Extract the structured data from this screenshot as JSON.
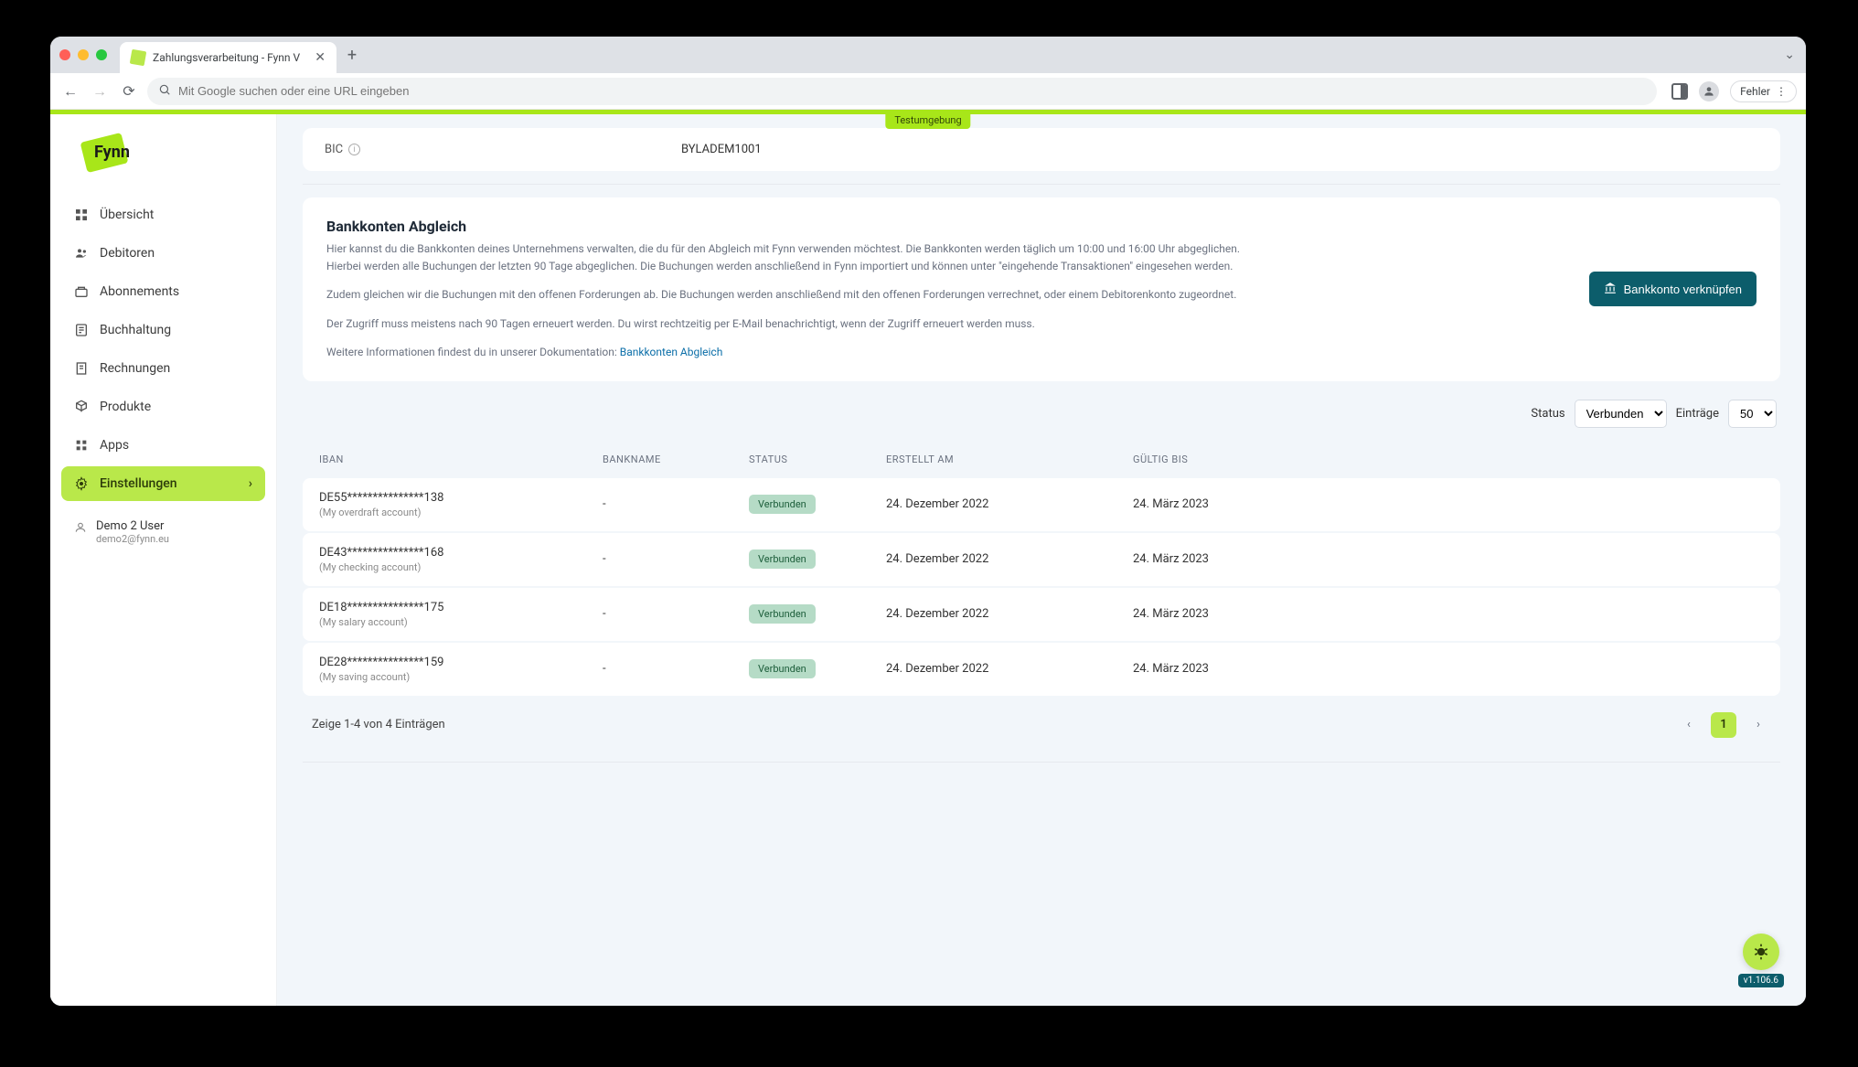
{
  "browser": {
    "tab_title": "Zahlungsverarbeitung - Fynn V",
    "address_placeholder": "Mit Google suchen oder eine URL eingeben",
    "error_label": "Fehler"
  },
  "env_badge": "Testumgebung",
  "logo_text": "Fynn",
  "sidebar": {
    "items": [
      {
        "label": "Übersicht",
        "icon": "dashboard-icon"
      },
      {
        "label": "Debitoren",
        "icon": "people-icon"
      },
      {
        "label": "Abonnements",
        "icon": "subscription-icon"
      },
      {
        "label": "Buchhaltung",
        "icon": "accounting-icon"
      },
      {
        "label": "Rechnungen",
        "icon": "invoice-icon"
      },
      {
        "label": "Produkte",
        "icon": "products-icon"
      },
      {
        "label": "Apps",
        "icon": "apps-icon"
      },
      {
        "label": "Einstellungen",
        "icon": "settings-icon"
      }
    ],
    "user": {
      "name": "Demo 2 User",
      "email": "demo2@fynn.eu"
    }
  },
  "bic": {
    "label": "BIC",
    "value": "BYLADEM1001"
  },
  "card": {
    "title": "Bankkonten Abgleich",
    "p1": "Hier kannst du die Bankkonten deines Unternehmens verwalten, die du für den Abgleich mit Fynn verwenden möchtest. Die Bankkonten werden täglich um 10:00 und 16:00 Uhr abgeglichen.",
    "p2": "Hierbei werden alle Buchungen der letzten 90 Tage abgeglichen. Die Buchungen werden anschließend in Fynn importiert und können unter \"eingehende Transaktionen\" eingesehen werden.",
    "p3": "Zudem gleichen wir die Buchungen mit den offenen Forderungen ab. Die Buchungen werden anschließend mit den offenen Forderungen verrechnet, oder einem Debitorenkonto zugeordnet.",
    "p4": "Der Zugriff muss meistens nach 90 Tagen erneuert werden. Du wirst rechtzeitig per E-Mail benachrichtigt, wenn der Zugriff erneuert werden muss.",
    "doc_prefix": "Weitere Informationen findest du in unserer Dokumentation: ",
    "doc_link": "Bankkonten Abgleich",
    "button": "Bankkonto verknüpfen"
  },
  "filters": {
    "status_label": "Status",
    "status_value": "Verbunden",
    "entries_label": "Einträge",
    "entries_value": "50"
  },
  "table": {
    "headers": {
      "iban": "IBAN",
      "bankname": "BANKNAME",
      "status": "STATUS",
      "created": "ERSTELLT AM",
      "valid": "GÜLTIG BIS"
    },
    "rows": [
      {
        "iban": "DE55***************138",
        "sub": "(My overdraft account)",
        "bank": "-",
        "status": "Verbunden",
        "created": "24. Dezember 2022",
        "valid": "24. März 2023"
      },
      {
        "iban": "DE43***************168",
        "sub": "(My checking account)",
        "bank": "-",
        "status": "Verbunden",
        "created": "24. Dezember 2022",
        "valid": "24. März 2023"
      },
      {
        "iban": "DE18***************175",
        "sub": "(My salary account)",
        "bank": "-",
        "status": "Verbunden",
        "created": "24. Dezember 2022",
        "valid": "24. März 2023"
      },
      {
        "iban": "DE28***************159",
        "sub": "(My saving account)",
        "bank": "-",
        "status": "Verbunden",
        "created": "24. Dezember 2022",
        "valid": "24. März 2023"
      }
    ],
    "footer": "Zeige 1-4 von 4 Einträgen",
    "page": "1"
  },
  "version": "v1.106.6"
}
